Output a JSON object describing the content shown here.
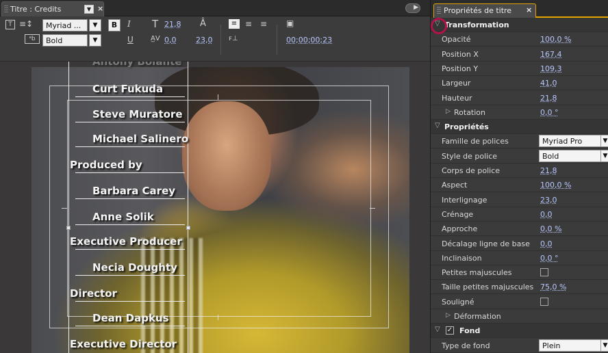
{
  "titler": {
    "tab_label": "Titre : Credits",
    "tab_menu_glyph": "▼",
    "tab_close": "×",
    "toolbar": {
      "font_family": "Myriad ...",
      "font_style": "Bold",
      "bold_label": "B",
      "italic_label": "I",
      "underline_label": "U",
      "font_size": "21,8",
      "kerning": "0,0",
      "leading": "23,0",
      "timecode": "00;00;00;23",
      "dropdown_glyph": "▼"
    }
  },
  "credits": [
    {
      "text": "Antony Bolante"
    },
    {
      "text": "Curt Fukuda"
    },
    {
      "text": "Steve Muratore"
    },
    {
      "text": "Michael Salinero"
    },
    {
      "text": "Produced by"
    },
    {
      "text": "Barbara Carey"
    },
    {
      "text": "Anne Solik"
    },
    {
      "text": "Executive Producer"
    },
    {
      "text": "Necia Doughty"
    },
    {
      "text": "Director"
    },
    {
      "text": "Dean Dapkus"
    },
    {
      "text": "Executive Director"
    }
  ],
  "props": {
    "tab_label": "Propriétés de titre",
    "tab_close": "×",
    "rows": [
      {
        "type": "section",
        "label": "Transformation"
      },
      {
        "type": "value",
        "label": "Opacité",
        "value": "100,0 %"
      },
      {
        "type": "value",
        "label": "Position X",
        "value": "167,4"
      },
      {
        "type": "value",
        "label": "Position Y",
        "value": "109,3"
      },
      {
        "type": "value",
        "label": "Largeur",
        "value": "41,0"
      },
      {
        "type": "value",
        "label": "Hauteur",
        "value": "21,8"
      },
      {
        "type": "sub",
        "label": "Rotation",
        "value": "0,0 °"
      },
      {
        "type": "section",
        "label": "Propriétés"
      },
      {
        "type": "select",
        "label": "Famille de polices",
        "value": "Myriad Pro"
      },
      {
        "type": "select",
        "label": "Style de police",
        "value": "Bold"
      },
      {
        "type": "value",
        "label": "Corps de police",
        "value": "21,8"
      },
      {
        "type": "value",
        "label": "Aspect",
        "value": "100,0 %"
      },
      {
        "type": "value",
        "label": "Interlignage",
        "value": "23,0"
      },
      {
        "type": "value",
        "label": "Crénage",
        "value": "0,0"
      },
      {
        "type": "value",
        "label": "Approche",
        "value": "0,0 %"
      },
      {
        "type": "value",
        "label": "Décalage ligne de base",
        "value": "0,0"
      },
      {
        "type": "value",
        "label": "Inclinaison",
        "value": "0,0 °"
      },
      {
        "type": "check",
        "label": "Petites majuscules",
        "checked": false
      },
      {
        "type": "value",
        "label": "Taille petites majuscules",
        "value": "75,0 %"
      },
      {
        "type": "check",
        "label": "Souligné",
        "checked": false
      },
      {
        "type": "sub",
        "label": "Déformation",
        "value": ""
      },
      {
        "type": "section-check",
        "label": "Fond",
        "checked": true
      },
      {
        "type": "select",
        "label": "Type de fond",
        "value": "Plein"
      }
    ]
  },
  "colors": {
    "value_link": "#b9c8ff",
    "tab_accent": "#e3a400",
    "highlight_circle": "#b3124a"
  }
}
